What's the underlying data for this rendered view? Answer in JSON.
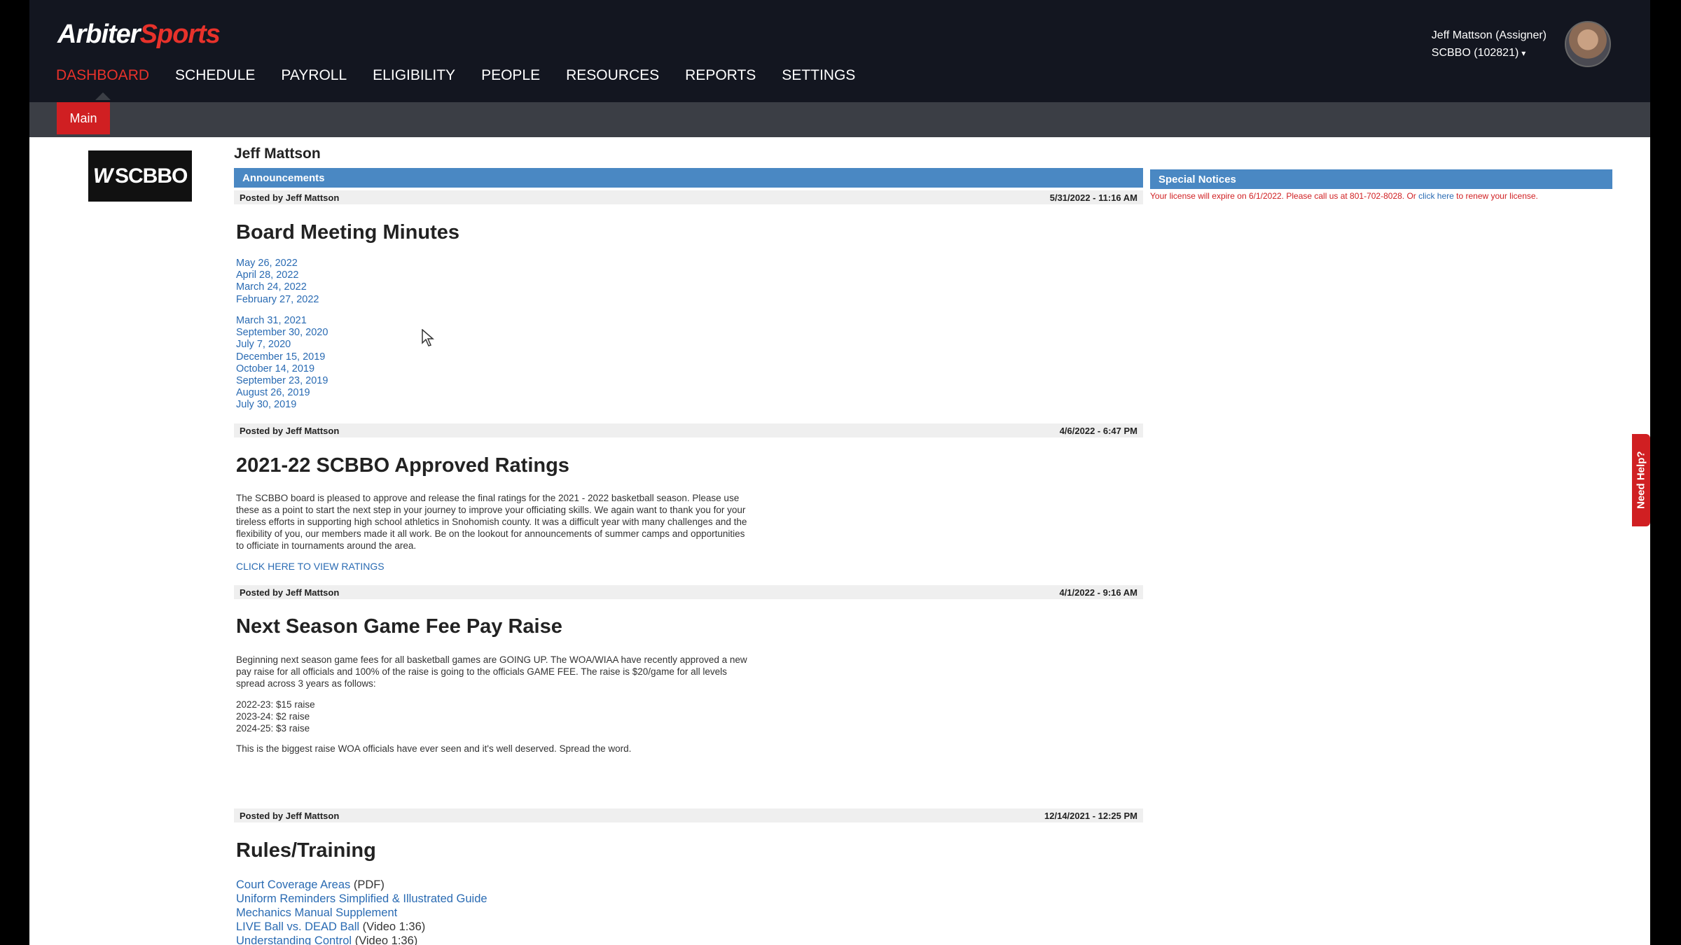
{
  "header": {
    "logo_part1": "Arbiter",
    "logo_part2": "Sports",
    "nav": [
      "DASHBOARD",
      "SCHEDULE",
      "PAYROLL",
      "ELIGIBILITY",
      "PEOPLE",
      "RESOURCES",
      "REPORTS",
      "SETTINGS"
    ],
    "user_name": "Jeff Mattson (Assigner)",
    "org": "SCBBO (102821)"
  },
  "subnav": {
    "tab": "Main"
  },
  "org_logo": "SCBBO",
  "page_name": "Jeff Mattson",
  "announcements": {
    "title": "Announcements",
    "posts": [
      {
        "author": "Posted by Jeff Mattson",
        "date": "5/31/2022 - 11:16 AM",
        "title": "Board Meeting Minutes",
        "links_group1": [
          "May 26, 2022",
          "April 28, 2022",
          "March 24, 2022",
          "February 27, 2022"
        ],
        "links_group2": [
          "March 31, 2021",
          "September 30, 2020",
          "July 7, 2020",
          "December 15, 2019",
          "October 14, 2019",
          "September 23, 2019",
          "August 26, 2019",
          "July 30, 2019"
        ]
      },
      {
        "author": "Posted by Jeff Mattson",
        "date": "4/6/2022 - 6:47 PM",
        "title": "2021-22 SCBBO Approved Ratings",
        "body": "The SCBBO board is pleased to approve and release the final ratings for the 2021 - 2022 basketball season. Please use these as a point to start the next step in your journey to improve your officiating skills. We again want to thank you for your tireless efforts in supporting high school athletics in Snohomish county. It was a difficult year with many challenges and the flexibility of you, our members made it all work. Be on the lookout for announcements of summer camps and opportunities to officiate in tournaments around the area.",
        "cta": "CLICK HERE TO VIEW RATINGS"
      },
      {
        "author": "Posted by Jeff Mattson",
        "date": "4/1/2022 - 9:16 AM",
        "title": "Next Season Game Fee Pay Raise",
        "body": "Beginning next season game fees for all basketball games are GOING UP. The WOA/WIAA have recently approved a new pay raise for all officials and 100% of the raise is going to the officials GAME FEE.  The raise is $20/game for all levels spread across 3 years as follows:",
        "list": [
          "2022-23: $15 raise",
          "2023-24: $2 raise",
          "2024-25: $3 raise"
        ],
        "footer": "This is the biggest raise WOA officials have ever seen and it's well deserved.  Spread the word."
      },
      {
        "author": "Posted by Jeff Mattson",
        "date": "12/14/2021 - 12:25 PM",
        "title": "Rules/Training",
        "items": [
          {
            "link": "Court Coverage Areas",
            "suffix": " (PDF)"
          },
          {
            "link": "Uniform Reminders Simplified & Illustrated Guide",
            "suffix": ""
          },
          {
            "link": "Mechanics Manual Supplement",
            "suffix": ""
          },
          {
            "link": "LIVE Ball vs. DEAD Ball",
            "suffix": " (Video 1:36)"
          },
          {
            "link": "Understanding Control",
            "suffix": " (Video 1:36)"
          }
        ]
      }
    ]
  },
  "special_notices": {
    "title": "Special Notices",
    "text_before": "Your license will expire on 6/1/2022. Please call us at 801-702-8028. Or ",
    "link": "click here",
    "text_after": " to renew your license."
  },
  "help_tab": "Need Help?"
}
